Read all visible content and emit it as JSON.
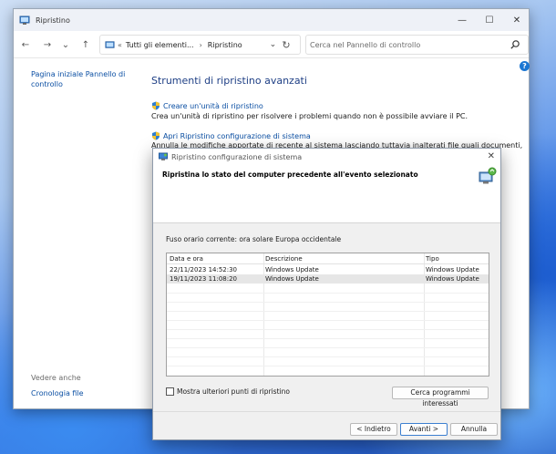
{
  "window": {
    "title": "Ripristino",
    "minimize": "—",
    "maximize": "☐",
    "close": "✕"
  },
  "address": {
    "back": "←",
    "forward": "→",
    "recent": "⌄",
    "up": "↑",
    "prefix": "«",
    "crumb1": "Tutti gli elementi...",
    "separator": "›",
    "crumb2": "Ripristino",
    "dropdown": "⌄",
    "refresh": "↻"
  },
  "search": {
    "placeholder": "Cerca nel Pannello di controllo"
  },
  "help": "?",
  "sidebar": {
    "home_link": "Pagina iniziale Pannello di controllo",
    "see_also_label": "Vedere anche",
    "history_link": "Cronologia file"
  },
  "main": {
    "heading": "Strumenti di ripristino avanzati",
    "task1_link": "Creare un'unità di ripristino",
    "task1_desc": "Crea un'unità di ripristino per risolvere i problemi quando non è possibile avviare il PC.",
    "task2_link": "Apri Ripristino configurazione di sistema",
    "task2_desc": "Annulla le modifiche apportate di recente al sistema lasciando tuttavia inalterati file quali documenti, immagini"
  },
  "dialog": {
    "title": "Ripristino configurazione di sistema",
    "close": "✕",
    "header": "Ripristina lo stato del computer precedente all'evento selezionato",
    "timezone": "Fuso orario corrente: ora solare Europa occidentale",
    "columns": [
      "Data e ora",
      "Descrizione",
      "Tipo"
    ],
    "sort_caret": "⌃",
    "rows": [
      {
        "date": "22/11/2023 14:52:30",
        "desc": "Windows Update",
        "type": "Windows Update"
      },
      {
        "date": "19/11/2023 11:08:20",
        "desc": "Windows Update",
        "type": "Windows Update"
      }
    ],
    "show_more": "Mostra ulteriori punti di ripristino",
    "scan_button": "Cerca programmi interessati",
    "back_button": "< Indietro",
    "next_button": "Avanti >",
    "cancel_button": "Annulla"
  },
  "colors": {
    "link": "#0b4fa3",
    "heading": "#1e3f85",
    "selected_row": "#e6e6e6"
  }
}
